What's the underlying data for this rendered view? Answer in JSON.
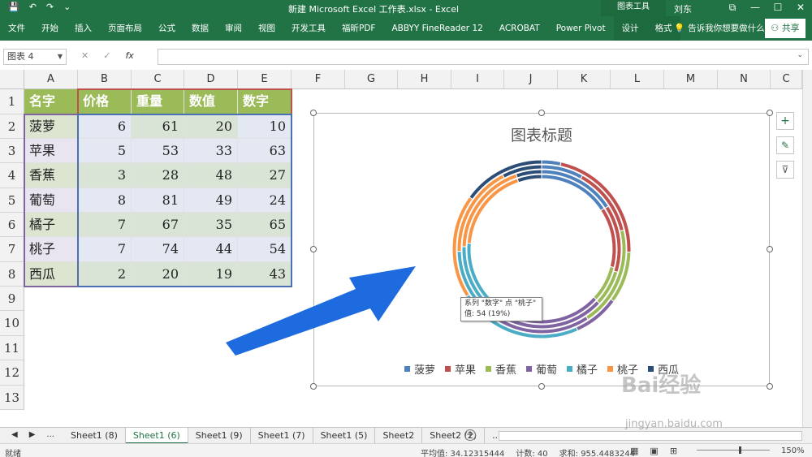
{
  "titlebar": {
    "qat": [
      "💾",
      "↶",
      "↷",
      "⌄"
    ],
    "title": "新建 Microsoft Excel 工作表.xlsx - Excel",
    "context_group": "图表工具",
    "user": "刘东",
    "window_buttons": [
      "⧉",
      "—",
      "☐",
      "✕"
    ]
  },
  "ribbon": {
    "tabs": [
      "文件",
      "开始",
      "插入",
      "页面布局",
      "公式",
      "数据",
      "审阅",
      "视图",
      "开发工具",
      "福昕PDF",
      "ABBYY FineReader 12",
      "ACROBAT",
      "Power Pivot"
    ],
    "context_tabs": [
      "设计",
      "格式"
    ],
    "tell_me": "告诉我你想要做什么",
    "share": "共享"
  },
  "formula_bar": {
    "name_box": "图表 4",
    "cancel": "✕",
    "confirm": "✓",
    "fx": "fx",
    "formula": ""
  },
  "grid": {
    "columns": [
      "A",
      "B",
      "C",
      "D",
      "E",
      "F",
      "G",
      "H",
      "I",
      "J",
      "K",
      "L",
      "M",
      "N",
      "C"
    ],
    "rows": [
      "1",
      "2",
      "3",
      "4",
      "5",
      "6",
      "7",
      "8",
      "9",
      "10",
      "11",
      "12",
      "13"
    ],
    "headers": [
      "名字",
      "价格",
      "重量",
      "数值",
      "数字"
    ],
    "data": [
      [
        "菠萝",
        "6",
        "61",
        "20",
        "10"
      ],
      [
        "苹果",
        "5",
        "53",
        "33",
        "63"
      ],
      [
        "香蕉",
        "3",
        "28",
        "48",
        "27"
      ],
      [
        "葡萄",
        "8",
        "81",
        "49",
        "24"
      ],
      [
        "橘子",
        "7",
        "67",
        "35",
        "65"
      ],
      [
        "桃子",
        "7",
        "74",
        "44",
        "54"
      ],
      [
        "西瓜",
        "2",
        "20",
        "19",
        "43"
      ]
    ]
  },
  "chart_data": {
    "type": "doughnut",
    "title": "图表标题",
    "categories": [
      "菠萝",
      "苹果",
      "香蕉",
      "葡萄",
      "橘子",
      "桃子",
      "西瓜"
    ],
    "series": [
      {
        "name": "价格",
        "values": [
          6,
          5,
          3,
          8,
          7,
          7,
          2
        ]
      },
      {
        "name": "重量",
        "values": [
          61,
          53,
          28,
          81,
          67,
          74,
          20
        ]
      },
      {
        "name": "数值",
        "values": [
          20,
          33,
          48,
          49,
          35,
          44,
          19
        ]
      },
      {
        "name": "数字",
        "values": [
          10,
          63,
          27,
          24,
          65,
          54,
          43
        ]
      }
    ],
    "colors": [
      "#4f81bd",
      "#c0504d",
      "#9bbb59",
      "#8064a2",
      "#4bacc6",
      "#f79646",
      "#2c4d75"
    ],
    "legend": "bottom",
    "tooltip": {
      "line1": "系列 \"数字\" 点 \"桃子\"",
      "line2": "值: 54 (19%)"
    }
  },
  "chart_side_buttons": [
    "+",
    "✎",
    "⊽"
  ],
  "sheet_tabs": {
    "nav": [
      "◀",
      "▶",
      "..."
    ],
    "tabs": [
      "Sheet1 (8)",
      "Sheet1 (6)",
      "Sheet1 (9)",
      "Sheet1 (7)",
      "Sheet1 (5)",
      "Sheet2",
      "Sheet2 (2)",
      "..."
    ],
    "active": "Sheet1 (6)",
    "add": "+"
  },
  "statusbar": {
    "ready": "就绪",
    "average": "平均值: 34.12315444",
    "count": "计数: 40",
    "sum": "求和: 955.4483244",
    "zoom": "150%"
  },
  "watermark": {
    "brand": "Bai经验",
    "url": "jingyan.baidu.com"
  }
}
